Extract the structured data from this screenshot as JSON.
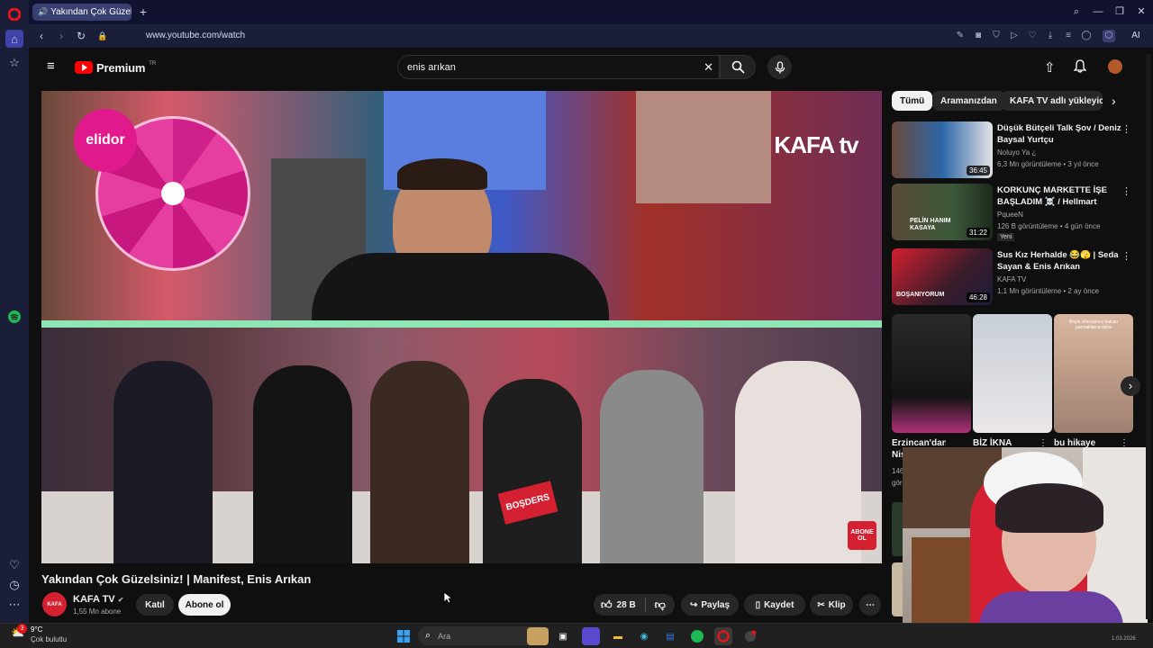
{
  "browser": {
    "tab_title": "Yakından Çok Güzelsin",
    "url": "www.youtube.com/watch",
    "ai_label": "AI"
  },
  "youtube": {
    "logo_text": "Premium",
    "logo_sup": "TR",
    "search_value": "enis arıkan"
  },
  "video": {
    "title": "Yakından Çok Güzelsiniz! | Manifest, Enis Arıkan",
    "overlay_brand": "elidor",
    "overlay_logo": "KAFA tv",
    "overlay_abone": "ABONE OL",
    "overlay_bosders": "BOŞDERS"
  },
  "channel": {
    "name": "KAFA TV",
    "subs": "1,55 Mn abone",
    "join_label": "Katıl",
    "subscribe_label": "Abone ol",
    "avatar_text": "KAFA"
  },
  "actions": {
    "likes": "28 B",
    "share": "Paylaş",
    "save": "Kaydet",
    "clip": "Klip",
    "more": "⋯"
  },
  "chips": [
    "Tümü",
    "Aramanızdan",
    "KAFA TV adlı yükleyiciden"
  ],
  "recommendations": [
    {
      "title": "Düşük Bütçeli Talk Şov / Deniz Baysal Yurtçu",
      "channel": "Noluyo Ya ¿",
      "meta": "6,3 Mn görüntüleme • 3 yıl önce",
      "duration": "36:45",
      "badge": ""
    },
    {
      "title": "KORKUNÇ MARKETTE İŞE BAŞLADIM ☠️ / Hellmart",
      "channel": "PqueeN",
      "meta": "126 B görüntüleme • 4 gün önce",
      "duration": "31:22",
      "badge": "Yeni"
    },
    {
      "title": "Sus Kız Herhalde 😂🫣 | Seda Sayan & Enis Arıkan",
      "channel": "KAFA TV",
      "meta": "1,1 Mn görüntüleme • 2 ay önce",
      "duration": "46:28",
      "badge": ""
    }
  ],
  "shorts": [
    {
      "title": "Erzincan'dan Nişantaşı",
      "views": "146",
      "views2": "görü"
    },
    {
      "title": "BİZ İKNA",
      "views": "",
      "views2": ""
    },
    {
      "title": "bu hikaye",
      "views": "",
      "views2": ""
    }
  ],
  "thumb_texts": {
    "rec2_overlay": "PELİN HANIM KASAYA",
    "rec3_overlay": "BOŞANIYORUM",
    "short3_overlay": "Boyle sileceyince kalcan parmaklarca daha"
  },
  "taskbar": {
    "weather_temp": "9°C",
    "weather_desc": "Çok bulutlu",
    "notif_count": "3",
    "search_placeholder": "Ara",
    "date": "1.03.2026"
  },
  "colors": {
    "yt_red": "#ff0000",
    "sidebar_bg": "#1b1e38",
    "spotify": "#1db954",
    "opera_red": "#e4141b"
  }
}
